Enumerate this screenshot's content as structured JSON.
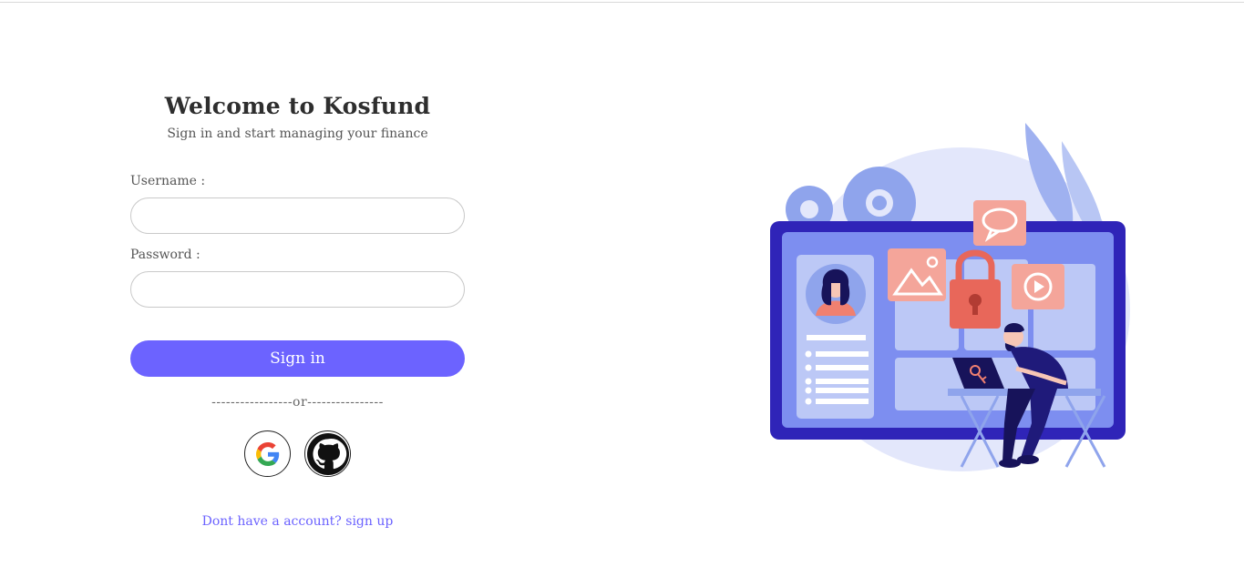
{
  "login": {
    "title": "Welcome to Kosfund",
    "subtitle": "Sign in and start managing your finance",
    "username_label": "Username :",
    "username_value": "",
    "password_label": "Password :",
    "password_value": "",
    "signin_label": "Sign in",
    "divider_text": "-----------------or----------------",
    "signup_text": "Dont have a account? sign up"
  },
  "social": {
    "icons": [
      "google-icon",
      "github-icon"
    ]
  },
  "colors": {
    "accent": "#6c63ff",
    "illustration_primary": "#3d32d6",
    "illustration_light": "#dfe4fb",
    "illustration_coral": "#f08070"
  }
}
